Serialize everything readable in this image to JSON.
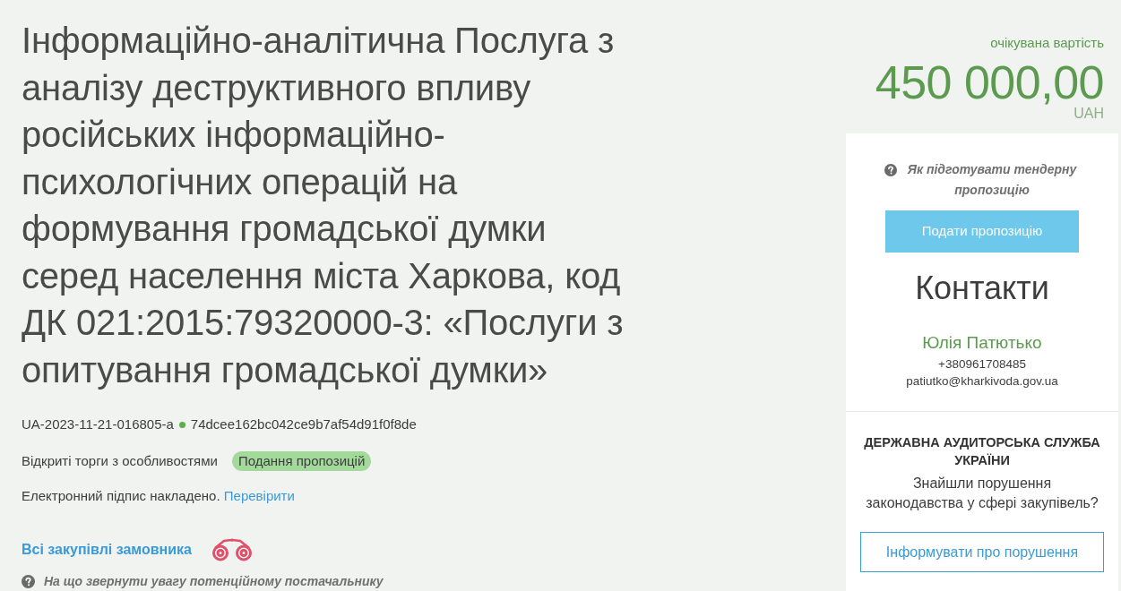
{
  "title": "Інформаційно-аналітична Послуга з аналізу деструктивного впливу російських інформаційно-психологічних операцій на формування громадської думки серед населення міста Харкова, код ДК 021:2015:79320000-3: «Послуги з опитування громадської думки»",
  "tender_id": "UA-2023-11-21-016805-a",
  "hash": "74dcee162bc042ce9b7af54d91f0f8de",
  "procedure_type": "Відкриті торги з особливостями",
  "status_badge": "Подання пропозицій",
  "signature": {
    "text": "Електронний підпис накладено.",
    "link": "Перевірити"
  },
  "customer_link": "Всі закупівлі замовника",
  "help_link": "На що звернути увагу потенційному постачальнику",
  "sidebar": {
    "value_label": "очікувана вартість",
    "amount": "450 000,00",
    "currency": "UAH",
    "help_link": "Як підготувати тендерну пропозицію",
    "submit_button": "Подати пропозицію",
    "contacts": {
      "heading": "Контакти",
      "name": "Юлія Патютько",
      "phone": "+380961708485",
      "email": "patiutko@kharkivoda.gov.ua"
    },
    "audit": {
      "heading": "ДЕРЖАВНА АУДИТОРСЬКА СЛУЖБА УКРАЇНИ",
      "question": "Знайшли порушення законодавства у сфері закупівель?",
      "button": "Інформувати про порушення"
    }
  }
}
